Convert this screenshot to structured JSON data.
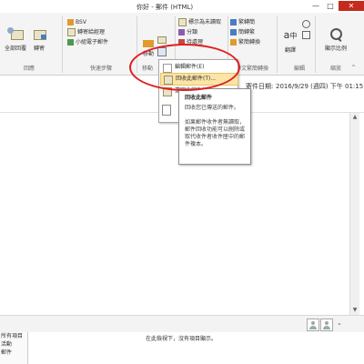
{
  "window": {
    "title": "你好 - 郵件 (HTML)",
    "min_glyph": "—",
    "max_glyph": "□",
    "close_glyph": "✕"
  },
  "ribbon": {
    "reply_all": "全部回覆",
    "forward": "轉寄",
    "group_respond": "回應",
    "quicksteps": {
      "item1": "BSV",
      "item2": "轉寄給經理",
      "item3": "小組電子郵件",
      "label": "快速步驟"
    },
    "group_move": "移動",
    "move_btn": "移動",
    "tags": {
      "mark_unread": "標示為未讀取",
      "categorize": "分類",
      "follow_up": "待處理"
    },
    "group_zh_conv": "中文繁簡轉換",
    "conv": {
      "s2t": "繁轉簡",
      "t2s": "簡轉繁",
      "s2t2": "繁簡轉換"
    },
    "translate": "翻譯",
    "group_editing": "編輯",
    "zoom": "縮放",
    "group_zoom": "縮放比例",
    "zoom_btn": "顯示比例"
  },
  "header": {
    "sent_label": "寄件日期:",
    "sent_value": "2016/9/29 (週四) 下午 01:15"
  },
  "dropdown": {
    "edit_message": "編輯郵件(E)",
    "recall_message": "回收此郵件(T)...",
    "resend_message": "重寄此郵件(S)..."
  },
  "tooltip": {
    "title": "回收此郵件",
    "p1": "回收您已傳送的郵件。",
    "p2": "如果郵件收件者無讀取，郵件回收功能可以刪除或取代收件者收件匣中的郵件複本。"
  },
  "people_pane": {
    "list": [
      "所有項目",
      "活動",
      "郵件"
    ],
    "message": "在此檢視下，沒有項目顯示。",
    "collapse_glyph": "⌄"
  }
}
